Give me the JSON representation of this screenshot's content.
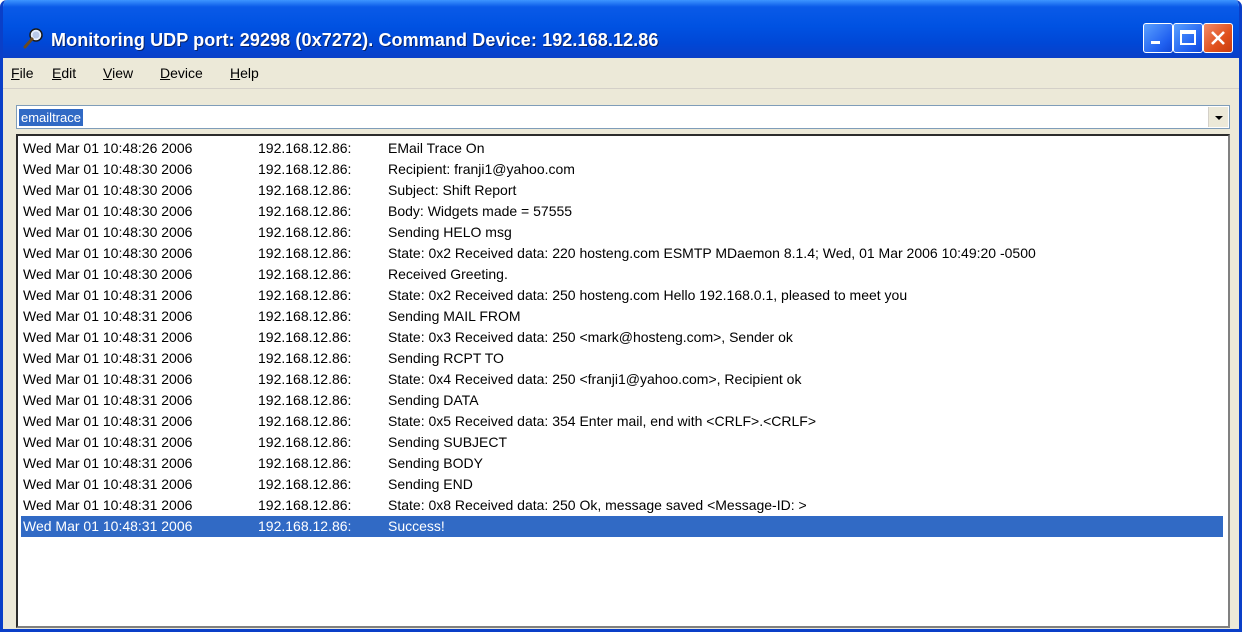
{
  "window": {
    "title": "Monitoring UDP port: 29298 (0x7272).  Command Device: 192.168.12.86"
  },
  "menu": [
    {
      "label": "File",
      "ul": "F",
      "rest": "ile"
    },
    {
      "label": "Edit",
      "ul": "E",
      "rest": "dit"
    },
    {
      "label": "View",
      "ul": "V",
      "rest": "iew"
    },
    {
      "label": "Device",
      "ul": "D",
      "rest": "evice"
    },
    {
      "label": "Help",
      "ul": "H",
      "rest": "elp"
    }
  ],
  "command": {
    "value": "emailtrace"
  },
  "log": [
    {
      "time": "Wed Mar 01 10:48:26 2006",
      "ip": "192.168.12.86:",
      "msg": "EMail Trace On"
    },
    {
      "time": "Wed Mar 01 10:48:30 2006",
      "ip": "192.168.12.86:",
      "msg": "Recipient: franji1@yahoo.com"
    },
    {
      "time": "Wed Mar 01 10:48:30 2006",
      "ip": "192.168.12.86:",
      "msg": "Subject: Shift Report"
    },
    {
      "time": "Wed Mar 01 10:48:30 2006",
      "ip": "192.168.12.86:",
      "msg": "Body: Widgets made =  57555"
    },
    {
      "time": "Wed Mar 01 10:48:30 2006",
      "ip": "192.168.12.86:",
      "msg": "Sending HELO msg"
    },
    {
      "time": "Wed Mar 01 10:48:30 2006",
      "ip": "192.168.12.86:",
      "msg": "State: 0x2  Received data: 220 hosteng.com ESMTP MDaemon 8.1.4; Wed, 01 Mar 2006 10:49:20 -0500"
    },
    {
      "time": "Wed Mar 01 10:48:30 2006",
      "ip": "192.168.12.86:",
      "msg": "Received Greeting."
    },
    {
      "time": "Wed Mar 01 10:48:31 2006",
      "ip": "192.168.12.86:",
      "msg": "State: 0x2  Received data: 250 hosteng.com Hello 192.168.0.1, pleased to meet you"
    },
    {
      "time": "Wed Mar 01 10:48:31 2006",
      "ip": "192.168.12.86:",
      "msg": "Sending MAIL FROM"
    },
    {
      "time": "Wed Mar 01 10:48:31 2006",
      "ip": "192.168.12.86:",
      "msg": "State: 0x3  Received data: 250 <mark@hosteng.com>, Sender ok"
    },
    {
      "time": "Wed Mar 01 10:48:31 2006",
      "ip": "192.168.12.86:",
      "msg": "Sending RCPT TO"
    },
    {
      "time": "Wed Mar 01 10:48:31 2006",
      "ip": "192.168.12.86:",
      "msg": "State: 0x4  Received data: 250 <franji1@yahoo.com>, Recipient ok"
    },
    {
      "time": "Wed Mar 01 10:48:31 2006",
      "ip": "192.168.12.86:",
      "msg": "Sending DATA"
    },
    {
      "time": "Wed Mar 01 10:48:31 2006",
      "ip": "192.168.12.86:",
      "msg": "State: 0x5  Received data: 354 Enter mail, end with <CRLF>.<CRLF>"
    },
    {
      "time": "Wed Mar 01 10:48:31 2006",
      "ip": "192.168.12.86:",
      "msg": "Sending SUBJECT"
    },
    {
      "time": "Wed Mar 01 10:48:31 2006",
      "ip": "192.168.12.86:",
      "msg": "Sending BODY"
    },
    {
      "time": "Wed Mar 01 10:48:31 2006",
      "ip": "192.168.12.86:",
      "msg": "Sending END"
    },
    {
      "time": "Wed Mar 01 10:48:31 2006",
      "ip": "192.168.12.86:",
      "msg": "State: 0x8  Received data: 250 Ok, message saved <Message-ID: >"
    },
    {
      "time": "Wed Mar 01 10:48:31 2006",
      "ip": "192.168.12.86:",
      "msg": "Success!",
      "selected": true
    }
  ],
  "colors": {
    "titlebar": "#0052e2",
    "selection": "#316ac5",
    "window_bg": "#ece9d8"
  },
  "icons": {
    "app": "magnifier-icon",
    "minimize": "minimize-icon",
    "maximize": "maximize-icon",
    "close": "close-icon",
    "dropdown": "chevron-down-icon"
  }
}
